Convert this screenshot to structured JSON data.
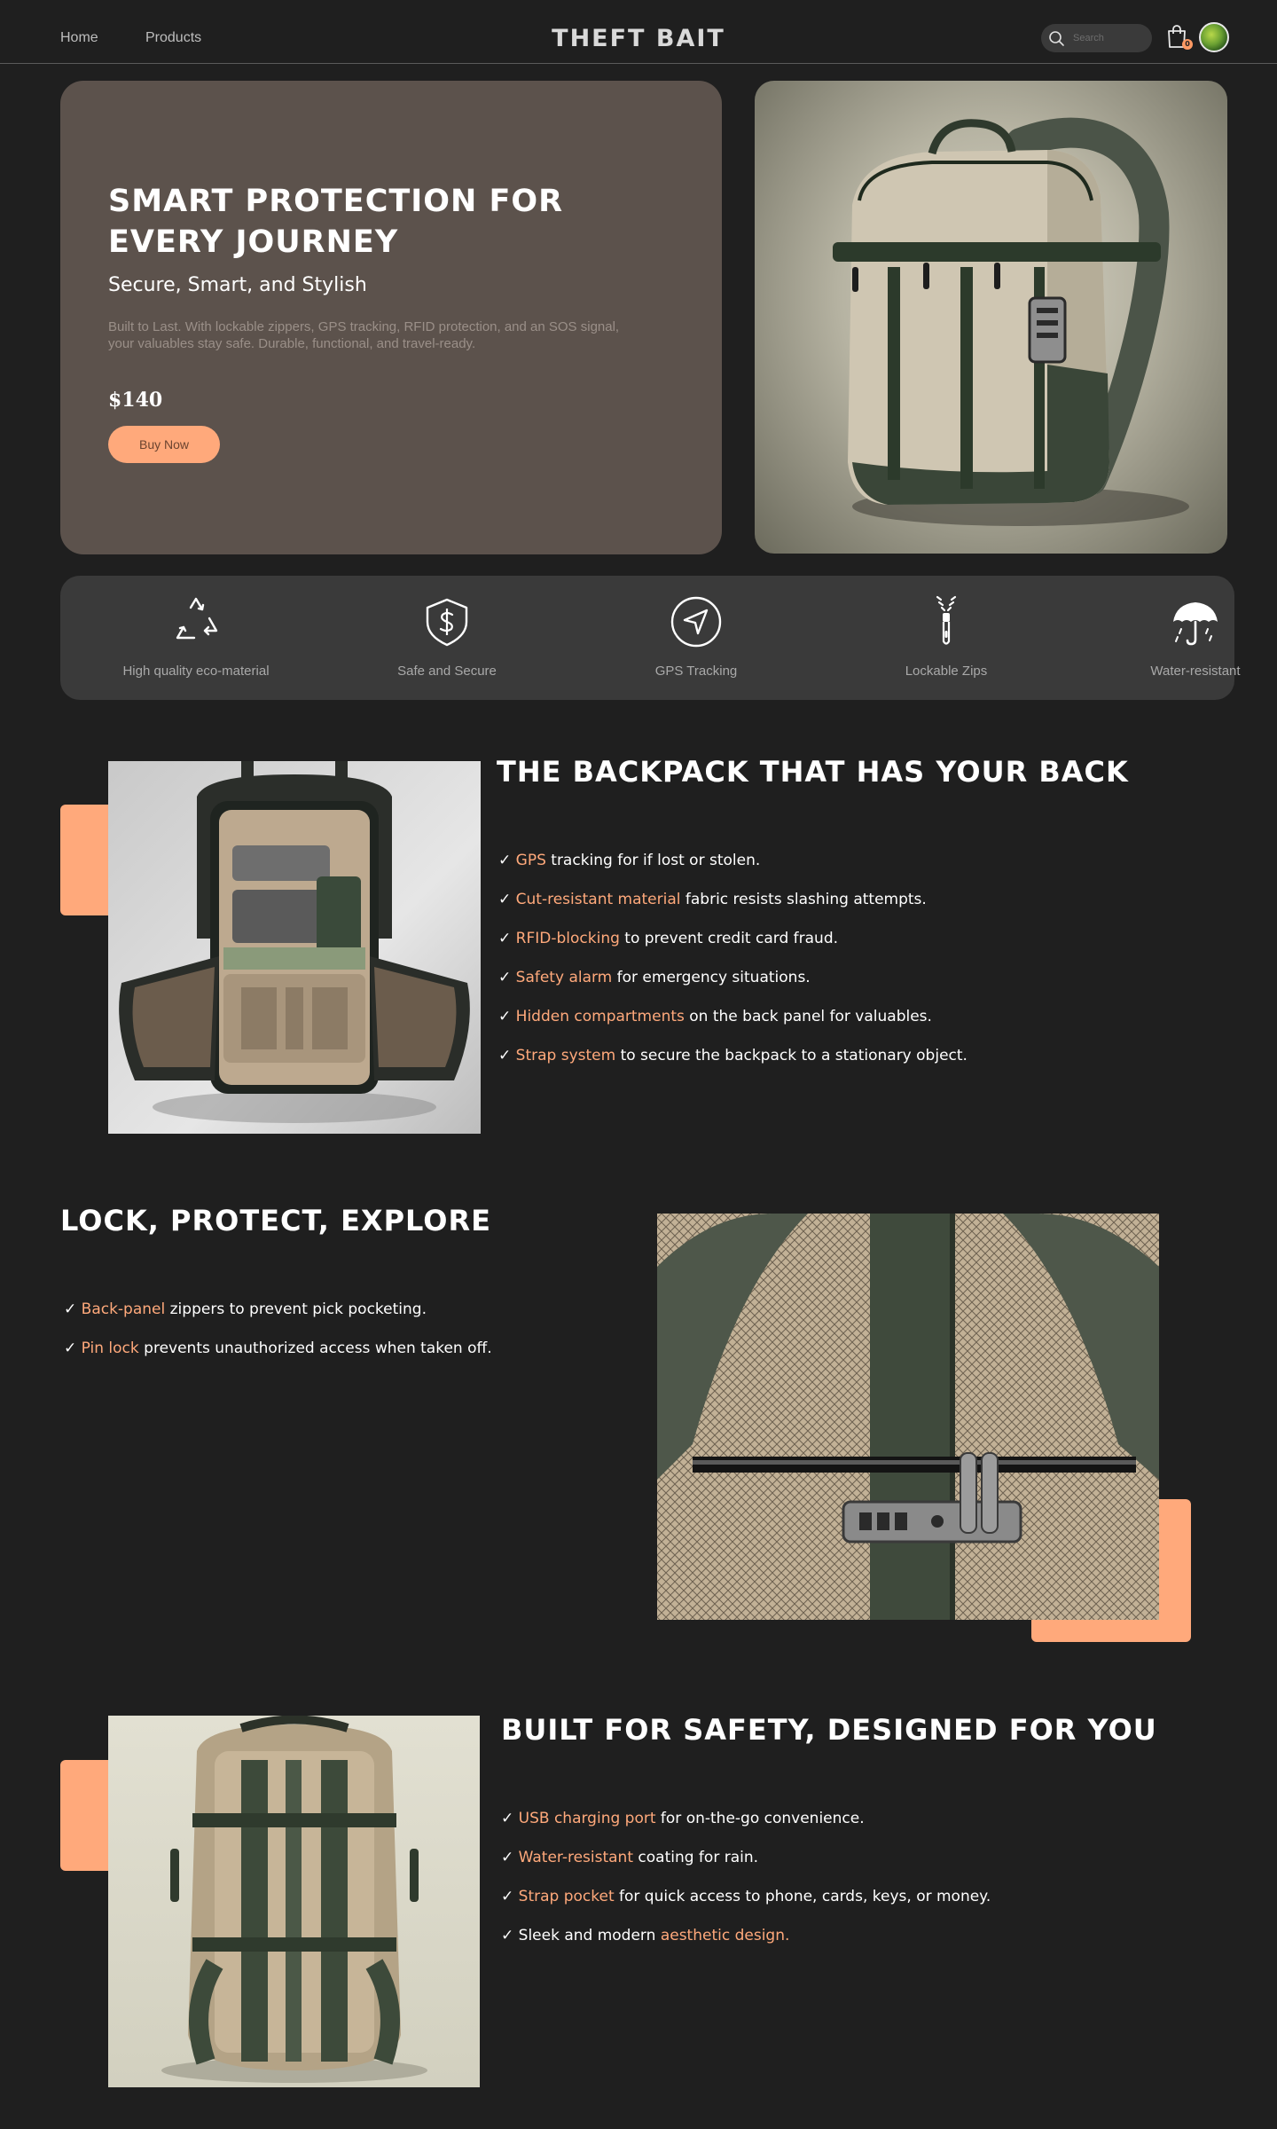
{
  "nav": {
    "home": "Home",
    "products": "Products",
    "brand": "THEFT BAIT",
    "search_placeholder": "Search",
    "cart_count": "0"
  },
  "hero": {
    "title": "SMART PROTECTION FOR EVERY JOURNEY",
    "subtitle": "Secure, Smart, and Stylish",
    "description": "Built to Last. With lockable zippers, GPS tracking, RFID protection, and an SOS signal, your valuables stay safe. Durable, functional, and travel-ready.",
    "price": "$140",
    "buy_label": "Buy Now"
  },
  "features": [
    {
      "icon": "recycle-icon",
      "label": "High quality eco-material"
    },
    {
      "icon": "shield-dollar-icon",
      "label": "Safe and Secure"
    },
    {
      "icon": "navigation-arrow-icon",
      "label": "GPS Tracking"
    },
    {
      "icon": "zipper-icon",
      "label": "Lockable Zips"
    },
    {
      "icon": "umbrella-icon",
      "label": "Water-resistant"
    }
  ],
  "section1": {
    "title": "THE BACKPACK THAT HAS YOUR BACK",
    "bullets": [
      {
        "highlight": "GPS",
        "text": " tracking for if lost or stolen."
      },
      {
        "highlight": "Cut-resistant material",
        "text": " fabric resists slashing attempts."
      },
      {
        "highlight": "RFID-blocking",
        "text": " to prevent credit card fraud."
      },
      {
        "highlight": "Safety alarm",
        "text": " for emergency situations."
      },
      {
        "highlight": "Hidden compartments",
        "text": " on the back panel for valuables."
      },
      {
        "highlight": "Strap system",
        "text": " to secure the backpack to a stationary object."
      }
    ]
  },
  "section2": {
    "title": "LOCK, PROTECT, EXPLORE",
    "bullets": [
      {
        "highlight": "Back-panel",
        "text": " zippers to prevent pick pocketing."
      },
      {
        "highlight": "Pin lock",
        "text": " prevents unauthorized access when taken off."
      }
    ]
  },
  "section3": {
    "title": "BUILT FOR SAFETY, DESIGNED FOR YOU",
    "bullets": [
      {
        "highlight": "USB charging port",
        "text": " for on-the-go convenience."
      },
      {
        "highlight": "Water-resistant",
        "text": " coating for rain."
      },
      {
        "highlight": "Strap pocket",
        "text": " for quick access to phone, cards, keys, or money."
      },
      {
        "pre": "Sleek and modern ",
        "highlight": "aesthetic design."
      }
    ]
  },
  "colors": {
    "background": "#1f1f1f",
    "accent": "#ffa97b",
    "hero_card": "#5c524c",
    "feature_bar": "#3a3a3a"
  }
}
